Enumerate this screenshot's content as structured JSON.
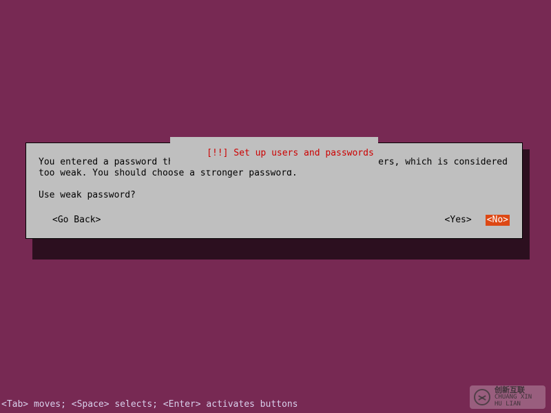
{
  "dialog": {
    "title": "[!!] Set up users and passwords",
    "message": "You entered a password that consists of less than eight characters, which is considered too weak. You should choose a stronger password.",
    "question": "Use weak password?",
    "buttons": {
      "go_back": "<Go Back>",
      "yes": "<Yes>",
      "no": "<No>",
      "selected": "no"
    }
  },
  "helpbar": "<Tab> moves; <Space> selects; <Enter> activates buttons",
  "watermark": {
    "line1": "创新互联",
    "line2": "CHUANG XIN HU LIAN"
  },
  "colors": {
    "background": "#772953",
    "dialog_bg": "#bfbfbf",
    "title_fg": "#cc0000",
    "selected_bg": "#dd4814",
    "selected_fg": "#ffffff"
  }
}
